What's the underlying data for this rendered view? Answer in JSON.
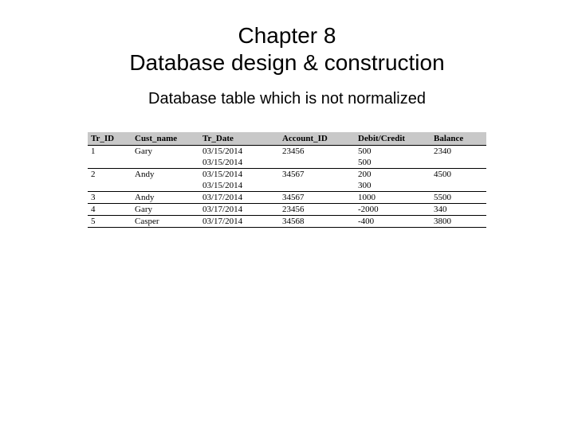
{
  "title": {
    "line1": "Chapter 8",
    "line2": "Database design & construction"
  },
  "subtitle": "Database table which is not normalized",
  "table": {
    "headers": {
      "tr_id": "Tr_ID",
      "cust_name": "Cust_name",
      "tr_date": "Tr_Date",
      "account_id": "Account_ID",
      "debit_credit": "Debit/Credit",
      "balance": "Balance"
    },
    "rows": [
      {
        "tr_id": "1",
        "cust_name": "Gary",
        "tr_date": "03/15/2014",
        "account_id": "23456",
        "debit_credit": "500",
        "balance": "2340",
        "sep": true
      },
      {
        "tr_id": "",
        "cust_name": "",
        "tr_date": "03/15/2014",
        "account_id": "",
        "debit_credit": "500",
        "balance": "",
        "sep": false
      },
      {
        "tr_id": "2",
        "cust_name": "Andy",
        "tr_date": "03/15/2014",
        "account_id": "34567",
        "debit_credit": "200",
        "balance": "4500",
        "sep": true
      },
      {
        "tr_id": "",
        "cust_name": "",
        "tr_date": "03/15/2014",
        "account_id": "",
        "debit_credit": "300",
        "balance": "",
        "sep": false
      },
      {
        "tr_id": "3",
        "cust_name": "Andy",
        "tr_date": "03/17/2014",
        "account_id": "34567",
        "debit_credit": "1000",
        "balance": "5500",
        "sep": true
      },
      {
        "tr_id": "4",
        "cust_name": "Gary",
        "tr_date": "03/17/2014",
        "account_id": "23456",
        "debit_credit": "-2000",
        "balance": "340",
        "sep": true
      },
      {
        "tr_id": "5",
        "cust_name": "Casper",
        "tr_date": "03/17/2014",
        "account_id": "34568",
        "debit_credit": "-400",
        "balance": "3800",
        "sep": true,
        "last": true
      }
    ]
  }
}
